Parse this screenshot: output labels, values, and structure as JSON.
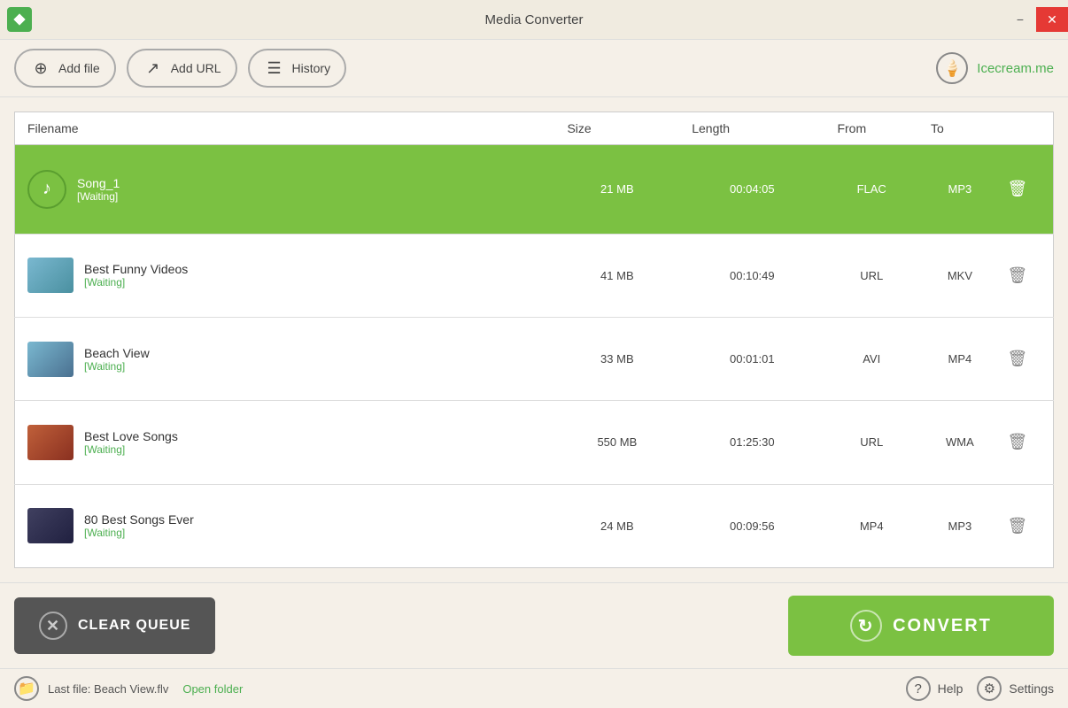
{
  "window": {
    "title": "Media Converter",
    "min_label": "−",
    "close_label": "✕"
  },
  "toolbar": {
    "add_file_label": "Add file",
    "add_url_label": "Add URL",
    "history_label": "History",
    "icecream_label": "Icecream.me"
  },
  "table": {
    "headers": {
      "filename": "Filename",
      "size": "Size",
      "length": "Length",
      "from": "From",
      "to": "To"
    },
    "rows": [
      {
        "id": "row-1",
        "name": "Song_1",
        "status": "[Waiting]",
        "size": "21 MB",
        "length": "00:04:05",
        "from": "FLAC",
        "to": "MP3",
        "selected": true,
        "thumb_type": "music"
      },
      {
        "id": "row-2",
        "name": "Best Funny Videos",
        "status": "[Waiting]",
        "size": "41 MB",
        "length": "00:10:49",
        "from": "URL",
        "to": "MKV",
        "selected": false,
        "thumb_type": "video1"
      },
      {
        "id": "row-3",
        "name": "Beach View",
        "status": "[Waiting]",
        "size": "33 MB",
        "length": "00:01:01",
        "from": "AVI",
        "to": "MP4",
        "selected": false,
        "thumb_type": "video2"
      },
      {
        "id": "row-4",
        "name": "Best Love Songs",
        "status": "[Waiting]",
        "size": "550 MB",
        "length": "01:25:30",
        "from": "URL",
        "to": "WMA",
        "selected": false,
        "thumb_type": "video3"
      },
      {
        "id": "row-5",
        "name": "80 Best Songs Ever",
        "status": "[Waiting]",
        "size": "24 MB",
        "length": "00:09:56",
        "from": "MP4",
        "to": "MP3",
        "selected": false,
        "thumb_type": "video4"
      }
    ]
  },
  "bottom": {
    "clear_queue_label": "CLEAR QUEUE",
    "convert_label": "CONVERT"
  },
  "statusbar": {
    "last_file_label": "Last file: Beach View.flv",
    "open_folder_label": "Open folder",
    "help_label": "Help",
    "settings_label": "Settings"
  }
}
